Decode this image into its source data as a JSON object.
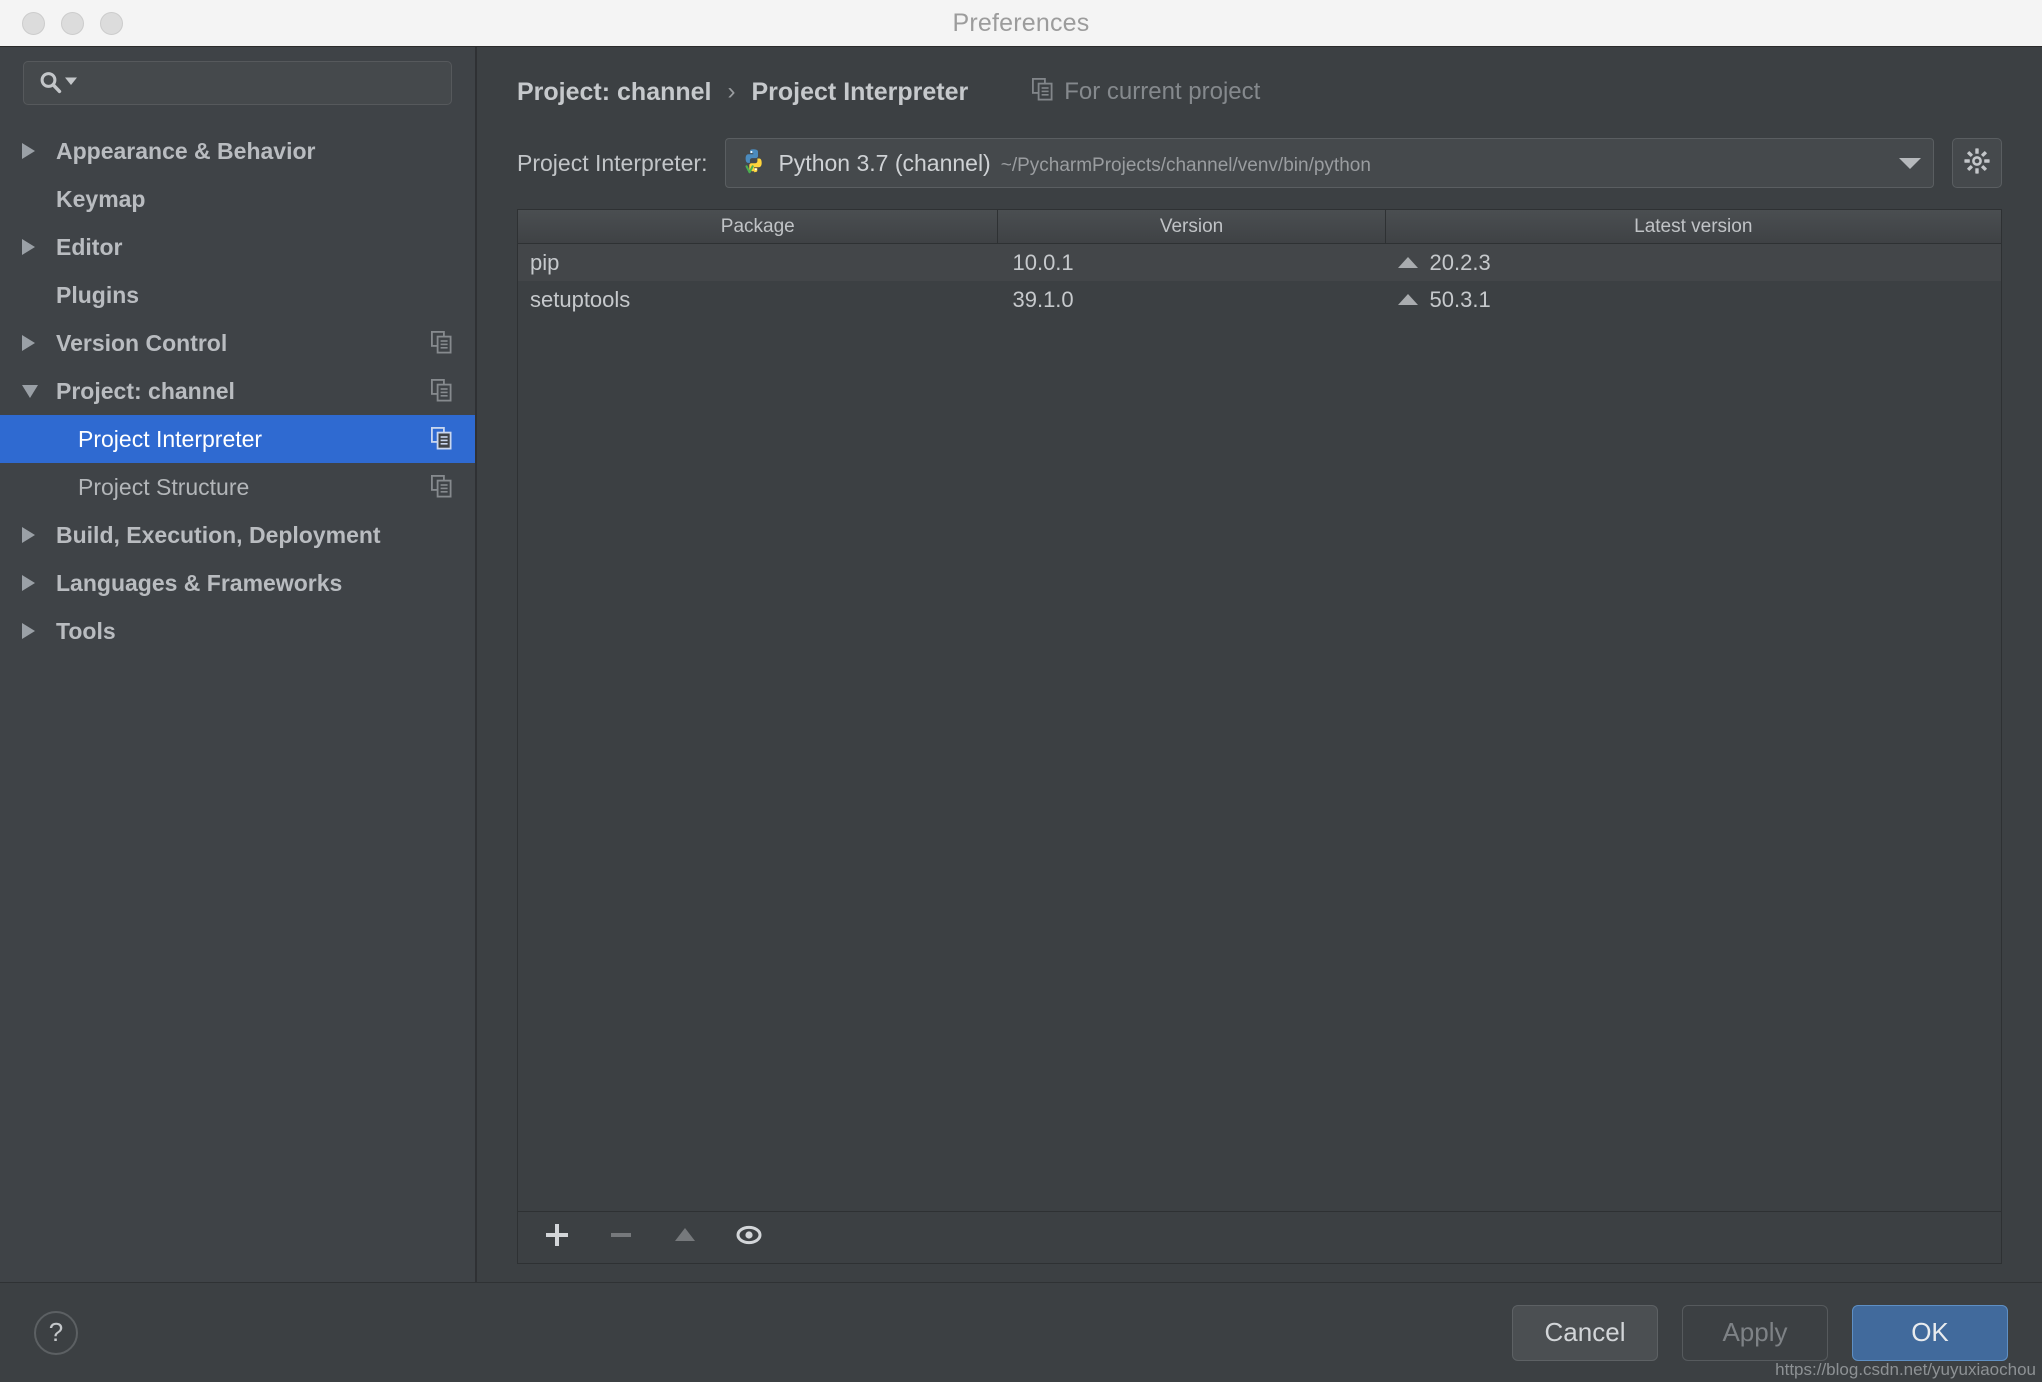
{
  "window": {
    "title": "Preferences",
    "traffic_lights": [
      "close",
      "minimize",
      "zoom"
    ]
  },
  "sidebar": {
    "search": {
      "placeholder": "",
      "value": ""
    },
    "items": [
      {
        "label": "Appearance & Behavior",
        "arrow": "right",
        "level": 0,
        "bold": true,
        "selected": false,
        "scope_icon": false
      },
      {
        "label": "Keymap",
        "arrow": "none",
        "level": 0,
        "bold": true,
        "selected": false,
        "scope_icon": false
      },
      {
        "label": "Editor",
        "arrow": "right",
        "level": 0,
        "bold": true,
        "selected": false,
        "scope_icon": false
      },
      {
        "label": "Plugins",
        "arrow": "none",
        "level": 0,
        "bold": true,
        "selected": false,
        "scope_icon": false
      },
      {
        "label": "Version Control",
        "arrow": "right",
        "level": 0,
        "bold": true,
        "selected": false,
        "scope_icon": true
      },
      {
        "label": "Project: channel",
        "arrow": "down",
        "level": 0,
        "bold": true,
        "selected": false,
        "scope_icon": true
      },
      {
        "label": "Project Interpreter",
        "arrow": "none",
        "level": 1,
        "bold": false,
        "selected": true,
        "scope_icon": true
      },
      {
        "label": "Project Structure",
        "arrow": "none",
        "level": 1,
        "bold": false,
        "selected": false,
        "scope_icon": true
      },
      {
        "label": "Build, Execution, Deployment",
        "arrow": "right",
        "level": 0,
        "bold": true,
        "selected": false,
        "scope_icon": false
      },
      {
        "label": "Languages & Frameworks",
        "arrow": "right",
        "level": 0,
        "bold": true,
        "selected": false,
        "scope_icon": false
      },
      {
        "label": "Tools",
        "arrow": "right",
        "level": 0,
        "bold": true,
        "selected": false,
        "scope_icon": false
      }
    ]
  },
  "main": {
    "breadcrumb": {
      "parent": "Project: channel",
      "separator": "›",
      "current": "Project Interpreter",
      "scope_label": "For current project"
    },
    "interpreter": {
      "label": "Project Interpreter:",
      "name": "Python 3.7 (channel)",
      "path": "~/PycharmProjects/channel/venv/bin/python",
      "settings_icon": "gear-icon",
      "dropdown_icon": "chevron-down-icon"
    },
    "packages_table": {
      "columns": [
        "Package",
        "Version",
        "Latest version"
      ],
      "rows": [
        {
          "package": "pip",
          "version": "10.0.1",
          "latest": "20.2.3",
          "upgradable": true
        },
        {
          "package": "setuptools",
          "version": "39.1.0",
          "latest": "50.3.1",
          "upgradable": true
        }
      ]
    },
    "table_toolbar": [
      {
        "icon": "plus-icon",
        "name": "install-package-button",
        "enabled": true
      },
      {
        "icon": "minus-icon",
        "name": "uninstall-package-button",
        "enabled": false
      },
      {
        "icon": "arrow-up-icon",
        "name": "upgrade-package-button",
        "enabled": false
      },
      {
        "icon": "eye-icon",
        "name": "show-early-releases-button",
        "enabled": true
      }
    ]
  },
  "footer": {
    "help_label": "?",
    "cancel_label": "Cancel",
    "apply_label": "Apply",
    "ok_label": "OK",
    "watermark": "https://blog.csdn.net/yuyuxiaochou"
  },
  "colors": {
    "selection_blue": "#2f6ad1",
    "primary_button": "#416a9c",
    "window_bg": "#3c4043",
    "sidebar_bg": "#3f4347",
    "titlebar_bg": "#f4f4f4"
  }
}
